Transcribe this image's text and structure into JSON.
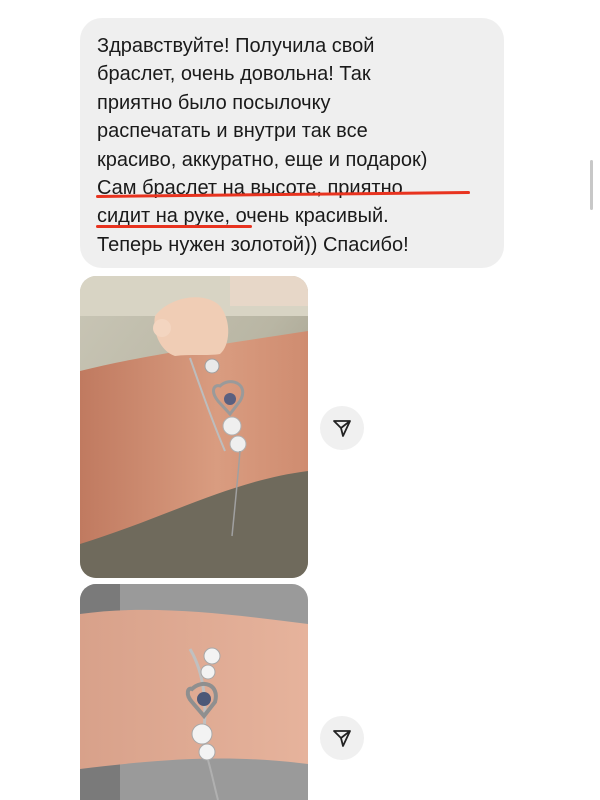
{
  "message": {
    "lines": [
      "Здравствуйте! Получила свой",
      "браслет, очень довольна! Так",
      "приятно было посылочку",
      "распечатать и внутри так все",
      "красиво, аккуратно, еще и подарок)",
      "Сам браслет на высоте, приятно",
      "сидит на руке, очень красивый.",
      "Теперь нужен золотой)) Спасибо!"
    ],
    "highlight_color": "#e8331f",
    "bubble_color": "#efefef"
  },
  "photos": [
    {
      "name": "bracelet-photo-1",
      "share_icon": "send-icon"
    },
    {
      "name": "bracelet-photo-2",
      "share_icon": "send-icon"
    }
  ]
}
